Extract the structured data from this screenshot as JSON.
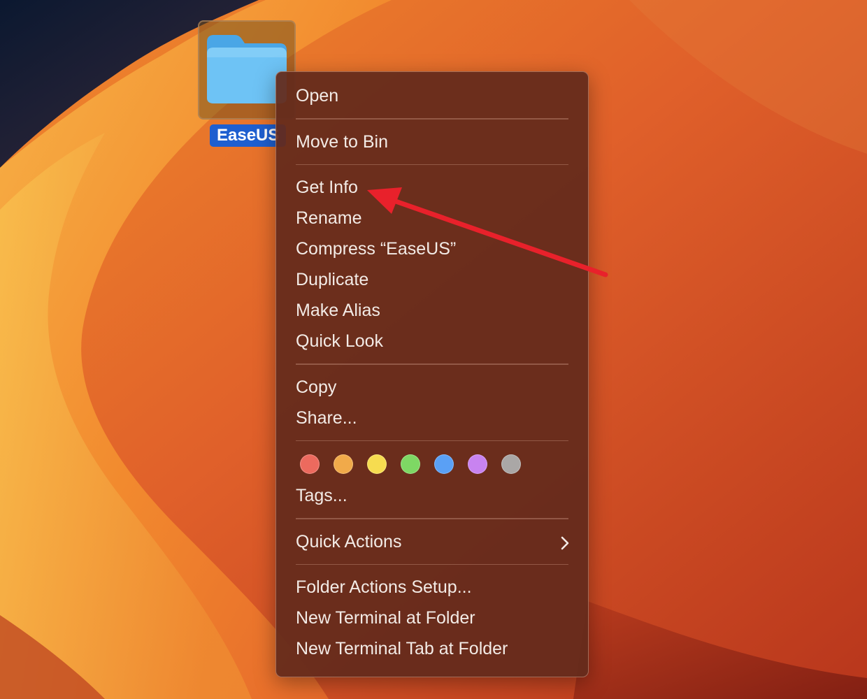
{
  "desktop": {
    "folder": {
      "name": "EaseUS",
      "icon": "folder-icon",
      "color": "#6ec3f5"
    }
  },
  "context_menu": {
    "sections": [
      {
        "items": [
          {
            "id": "open",
            "label": "Open"
          }
        ]
      },
      {
        "items": [
          {
            "id": "move-to-bin",
            "label": "Move to Bin"
          }
        ]
      },
      {
        "items": [
          {
            "id": "get-info",
            "label": "Get Info"
          },
          {
            "id": "rename",
            "label": "Rename"
          },
          {
            "id": "compress",
            "label": "Compress “EaseUS”"
          },
          {
            "id": "duplicate",
            "label": "Duplicate"
          },
          {
            "id": "make-alias",
            "label": "Make Alias"
          },
          {
            "id": "quick-look",
            "label": "Quick Look"
          }
        ]
      },
      {
        "items": [
          {
            "id": "copy",
            "label": "Copy"
          },
          {
            "id": "share",
            "label": "Share..."
          }
        ]
      }
    ],
    "tags": {
      "colors": [
        {
          "name": "red-tag",
          "color": "#ec6a5e"
        },
        {
          "name": "orange-tag",
          "color": "#f1aa4a"
        },
        {
          "name": "yellow-tag",
          "color": "#f6dc50"
        },
        {
          "name": "green-tag",
          "color": "#7ed864"
        },
        {
          "name": "blue-tag",
          "color": "#5aa0f5"
        },
        {
          "name": "purple-tag",
          "color": "#c883f0"
        },
        {
          "name": "gray-tag",
          "color": "#aaa7a6"
        }
      ],
      "label": "Tags..."
    },
    "quick_actions": {
      "label": "Quick Actions",
      "submenu_icon": "chevron-right-icon"
    },
    "folder_section": [
      {
        "id": "folder-actions-setup",
        "label": "Folder Actions Setup..."
      },
      {
        "id": "new-terminal-at-folder",
        "label": "New Terminal at Folder"
      },
      {
        "id": "new-terminal-tab-at-folder",
        "label": "New Terminal Tab at Folder"
      }
    ]
  },
  "annotation": {
    "type": "arrow",
    "color": "#e8212b",
    "points_to": "get-info"
  }
}
